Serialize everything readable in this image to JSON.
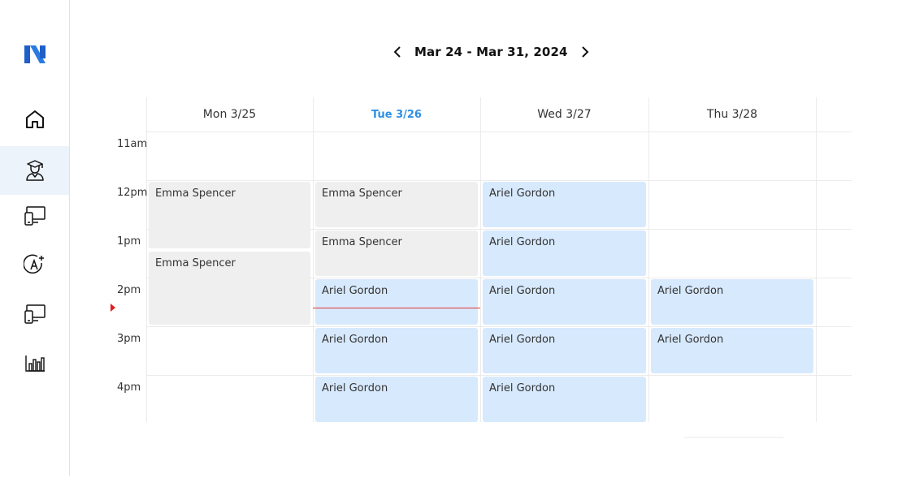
{
  "sidebar": {
    "logo_icon": "brand-n-logo",
    "items": [
      {
        "icon": "home-icon",
        "active": false
      },
      {
        "icon": "student-icon",
        "active": true
      },
      {
        "icon": "devices-icon",
        "active": false
      },
      {
        "icon": "add-account-icon",
        "active": false
      },
      {
        "icon": "devices-alt-icon",
        "active": false
      },
      {
        "icon": "bar-chart-icon",
        "active": false
      }
    ]
  },
  "calendar": {
    "range_label": "Mar 24 - Mar 31, 2024",
    "days": [
      {
        "label": "Mon 3/25",
        "today": false
      },
      {
        "label": "Tue 3/26",
        "today": true
      },
      {
        "label": "Wed 3/27",
        "today": false
      },
      {
        "label": "Thu 3/28",
        "today": false
      }
    ],
    "times": [
      "11am",
      "12pm",
      "1pm",
      "2pm",
      "3pm",
      "4pm"
    ],
    "events": [
      {
        "day": 0,
        "start": 1,
        "duration": 1.43,
        "name": "Emma Spencer",
        "color": "grey"
      },
      {
        "day": 0,
        "start": 2.43,
        "duration": 1.57,
        "name": "Emma Spencer",
        "color": "grey"
      },
      {
        "day": 1,
        "start": 1,
        "duration": 1,
        "name": "Emma Spencer",
        "color": "grey"
      },
      {
        "day": 1,
        "start": 2,
        "duration": 1,
        "name": "Emma Spencer",
        "color": "grey"
      },
      {
        "day": 1,
        "start": 3,
        "duration": 1,
        "name": "Ariel Gordon",
        "color": "blue"
      },
      {
        "day": 1,
        "start": 4,
        "duration": 1,
        "name": "Ariel Gordon",
        "color": "blue"
      },
      {
        "day": 1,
        "start": 5,
        "duration": 1,
        "name": "Ariel Gordon",
        "color": "blue"
      },
      {
        "day": 2,
        "start": 1,
        "duration": 1,
        "name": "Ariel Gordon",
        "color": "blue"
      },
      {
        "day": 2,
        "start": 2,
        "duration": 1,
        "name": "Ariel Gordon",
        "color": "blue"
      },
      {
        "day": 2,
        "start": 3,
        "duration": 1,
        "name": "Ariel Gordon",
        "color": "blue"
      },
      {
        "day": 2,
        "start": 4,
        "duration": 1,
        "name": "Ariel Gordon",
        "color": "blue"
      },
      {
        "day": 2,
        "start": 5,
        "duration": 1,
        "name": "Ariel Gordon",
        "color": "blue"
      },
      {
        "day": 3,
        "start": 3,
        "duration": 1,
        "name": "Ariel Gordon",
        "color": "blue"
      },
      {
        "day": 3,
        "start": 4,
        "duration": 1,
        "name": "Ariel Gordon",
        "color": "blue"
      }
    ],
    "now_day": 1,
    "now_slot": 3.62
  },
  "colors": {
    "accent": "#2f8fe6",
    "event_blue": "#d7e9fd",
    "event_grey": "#efefef",
    "now_line": "#e23434"
  }
}
